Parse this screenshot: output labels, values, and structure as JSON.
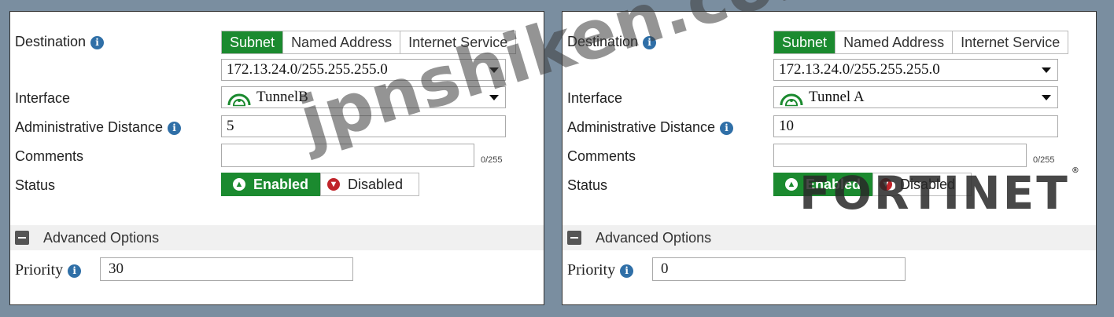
{
  "left": {
    "destination_label": "Destination",
    "tabs": [
      "Subnet",
      "Named Address",
      "Internet Service"
    ],
    "subnet_value": "172.13.24.0/255.255.255.0",
    "interface_label": "Interface",
    "interface_value": "TunnelB",
    "admin_distance_label": "Administrative Distance",
    "admin_distance_value": "5",
    "comments_label": "Comments",
    "comments_counter": "0/255",
    "status_label": "Status",
    "enabled_label": "Enabled",
    "disabled_label": "Disabled",
    "advanced_label": "Advanced Options",
    "priority_label": "Priority",
    "priority_value": "30"
  },
  "right": {
    "destination_label": "Destination",
    "tabs": [
      "Subnet",
      "Named Address",
      "Internet Service"
    ],
    "subnet_value": "172.13.24.0/255.255.255.0",
    "interface_label": "Interface",
    "interface_value": "Tunnel A",
    "admin_distance_label": "Administrative Distance",
    "admin_distance_value": "10",
    "comments_label": "Comments",
    "comments_counter": "0/255",
    "status_label": "Status",
    "enabled_label": "Enabled",
    "disabled_label": "Disabled",
    "advanced_label": "Advanced Options",
    "priority_label": "Priority",
    "priority_value": "0"
  },
  "watermark": "jpnshiken.com",
  "logo": "FORTINET",
  "icons": {
    "info": "info-icon",
    "tunnel": "tunnel-icon",
    "enabled": "arrow-up-circle-icon",
    "disabled": "arrow-down-circle-icon",
    "collapse": "minus-square-icon"
  },
  "colors": {
    "accent_green": "#1b8a2f",
    "info_blue": "#2f6fa7",
    "disabled_red": "#c0242a",
    "background": "#7a8ea0"
  }
}
